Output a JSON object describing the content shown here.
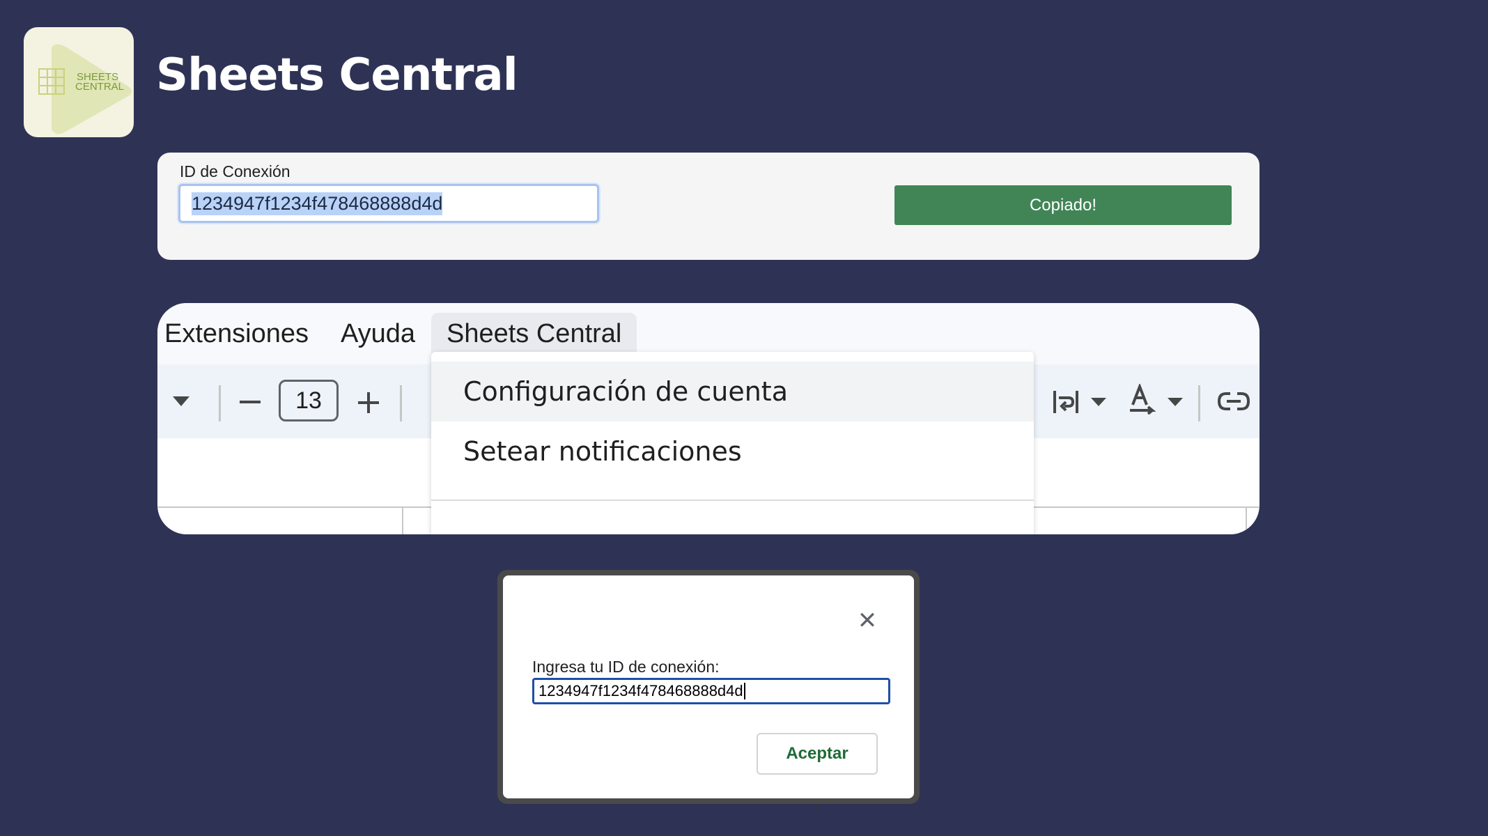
{
  "app": {
    "title": "Sheets Central",
    "logo_text_line1": "SHEETS",
    "logo_text_line2": "CENTRAL"
  },
  "connection_card": {
    "label": "ID de Conexión",
    "input_value": "1234947f1234f478468888d4d",
    "copy_button_label": "Copiado!"
  },
  "sheets_menu": {
    "menubar": [
      "Extensiones",
      "Ayuda",
      "Sheets Central"
    ],
    "active_menu": "Sheets Central",
    "font_size": "13",
    "dropdown_items": [
      "Configuración de cuenta",
      "Setear notificaciones"
    ]
  },
  "dialog": {
    "label": "Ingresa tu ID de conexión:",
    "input_value": "1234947f1234f478468888d4d",
    "accept_label": "Aceptar"
  },
  "colors": {
    "background": "#2e3355",
    "copy_button": "#418557",
    "accept_text": "#1f6b35",
    "input_focus": "#1f4ea8"
  }
}
